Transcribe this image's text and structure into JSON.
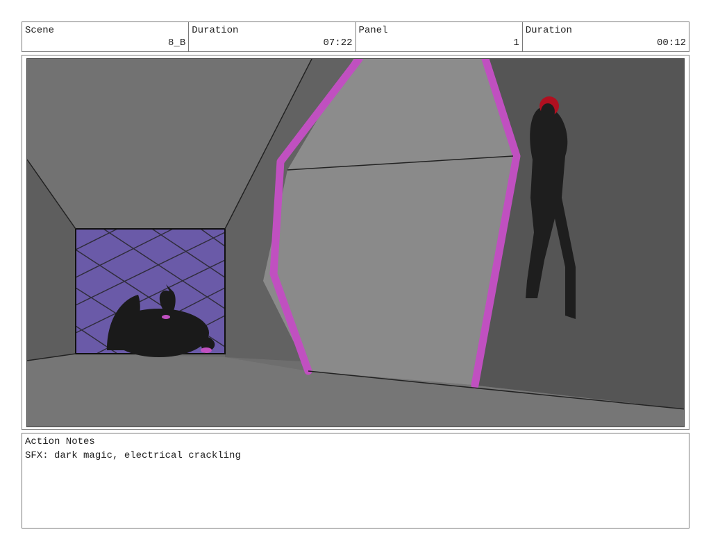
{
  "header": {
    "scene_label": "Scene",
    "scene_value": "8_B",
    "duration_label": "Duration",
    "duration_value": "07:22",
    "panel_label": "Panel",
    "panel_value": "1",
    "panel_duration_label": "Duration",
    "panel_duration_value": "00:12"
  },
  "notes": {
    "title": "Action Notes",
    "text": "SFX: dark magic, electrical crackling"
  },
  "colors": {
    "magic": "#c050c0",
    "cage": "#6a5aa8",
    "wall": "#6e6e6e",
    "door": "#8a8a8a",
    "floor": "#7a7a7a",
    "hair": "#b01020"
  }
}
